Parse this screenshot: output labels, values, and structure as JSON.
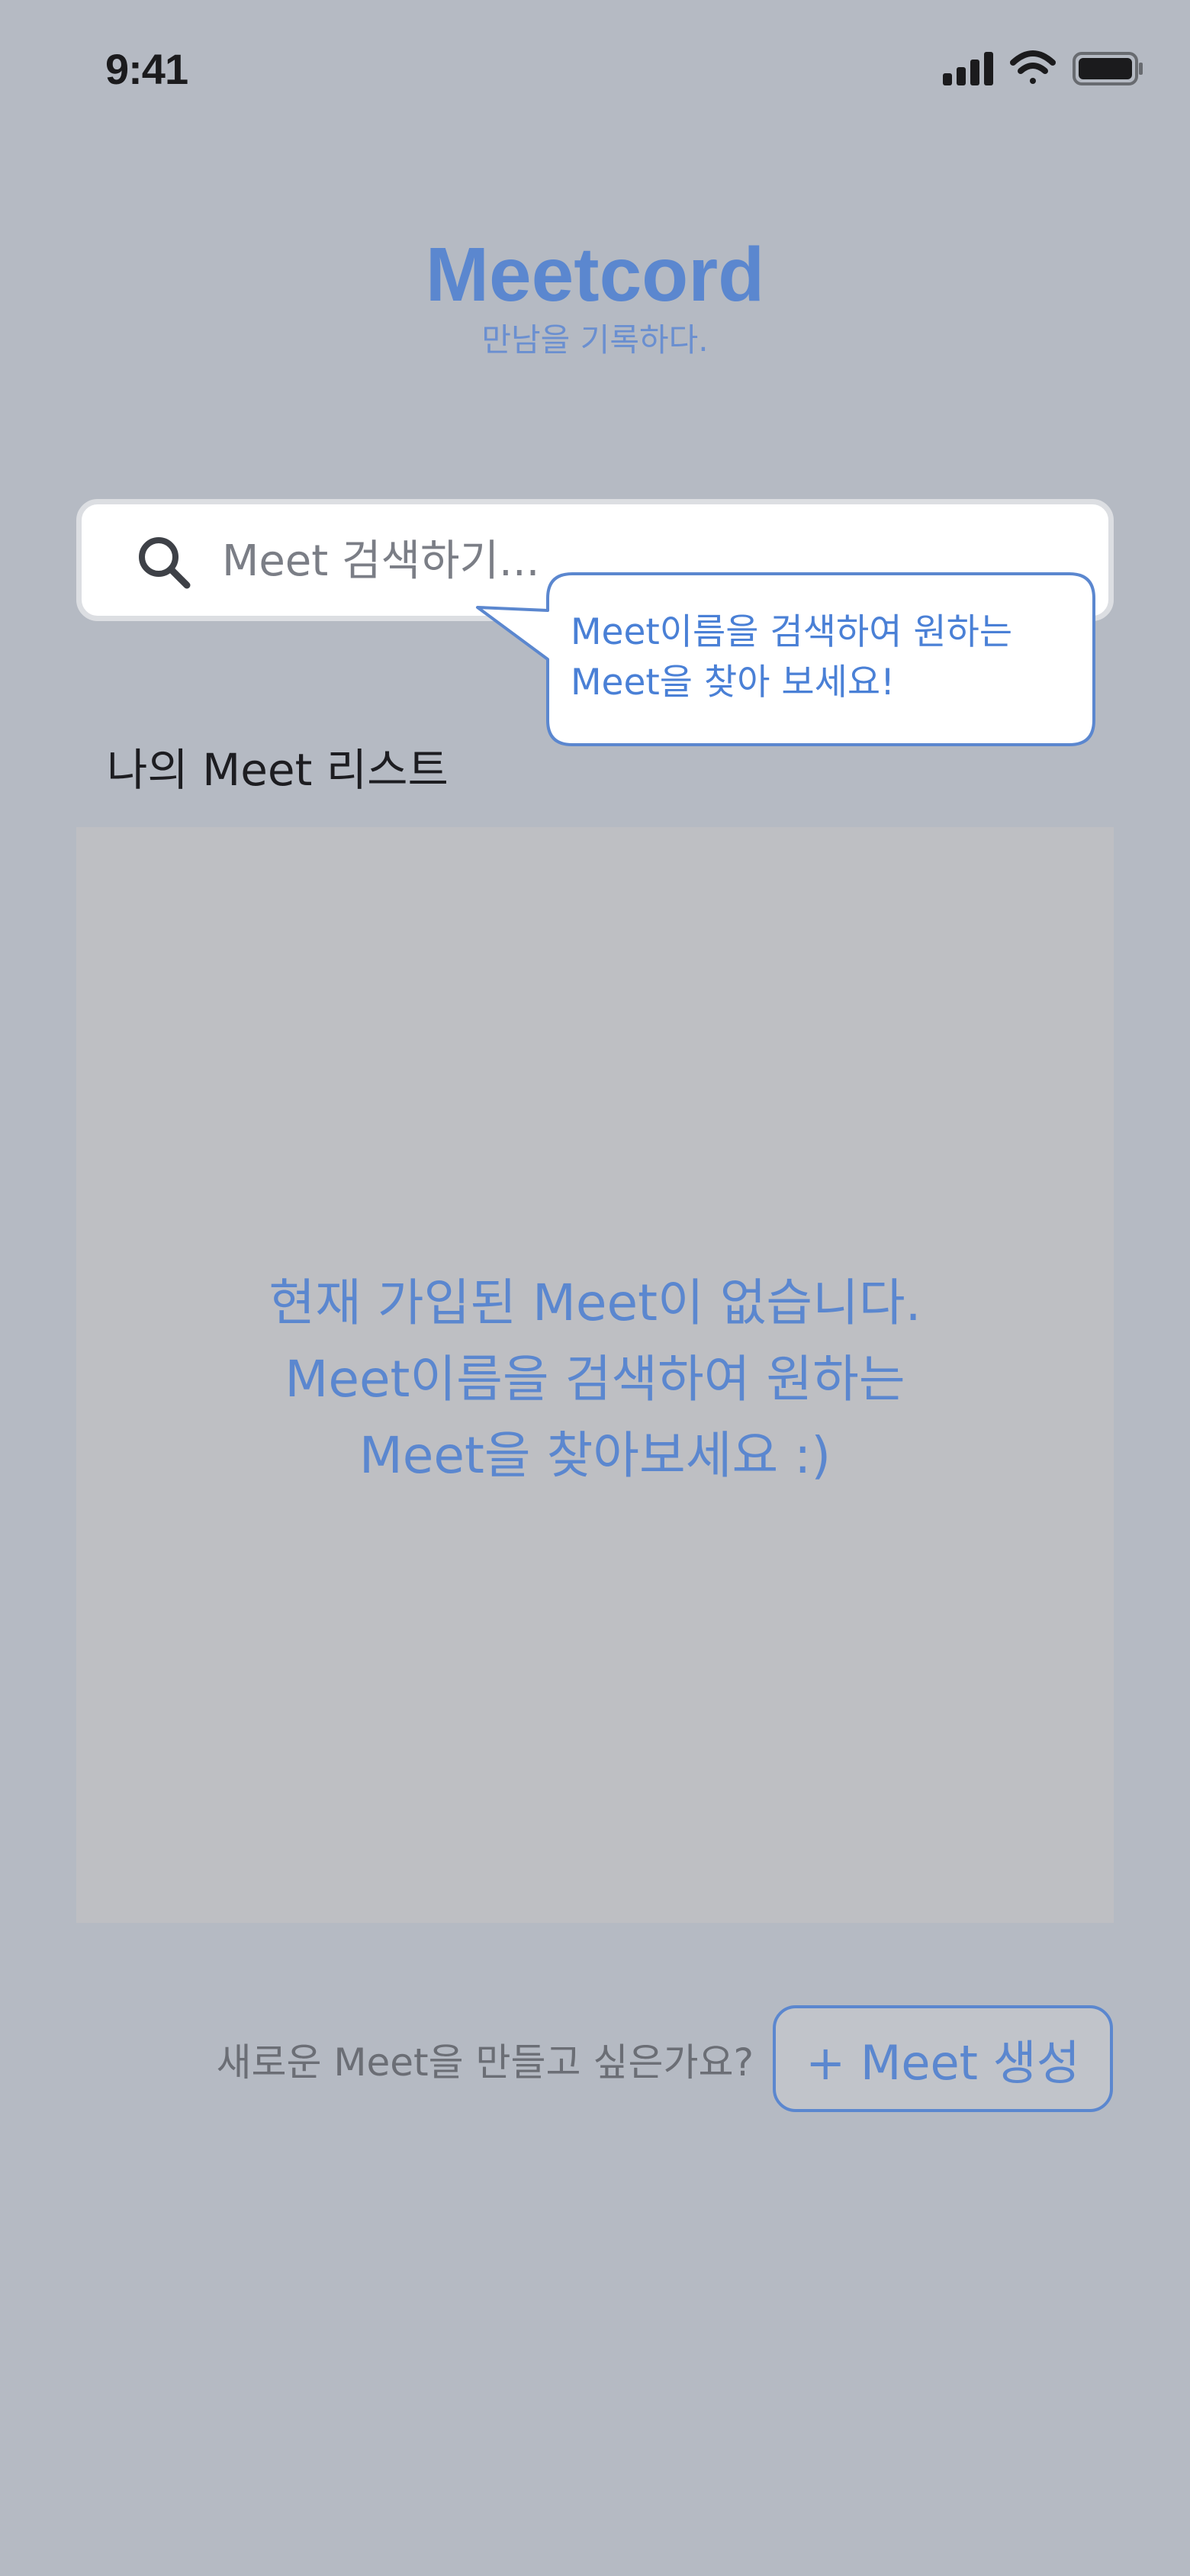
{
  "status_bar": {
    "time": "9:41",
    "icons": [
      "signal-icon",
      "wifi-icon",
      "battery-icon"
    ]
  },
  "brand": {
    "title": "Meetcord",
    "subtitle": "만남을 기록하다."
  },
  "search": {
    "placeholder": "Meet 검색하기...",
    "value": "",
    "icon": "search-icon"
  },
  "tooltip": {
    "line1": "Meet이름을 검색하여 원하는",
    "line2": "Meet을 찾아 보세요!"
  },
  "my_meet_list": {
    "title": "나의 Meet 리스트",
    "items": [],
    "empty_message": [
      "현재 가입된 Meet이 없습니다.",
      "Meet이름을 검색하여 원하는",
      "Meet을 찾아보세요 :)"
    ]
  },
  "create": {
    "prompt": "새로운 Meet을 만들고 싶은가요?",
    "button_label": "+ Meet 생성"
  },
  "colors": {
    "background": "#b5bac3",
    "accent": "#5b87cf",
    "list_background": "#bebfc3",
    "tooltip_border": "#5b87cf"
  }
}
